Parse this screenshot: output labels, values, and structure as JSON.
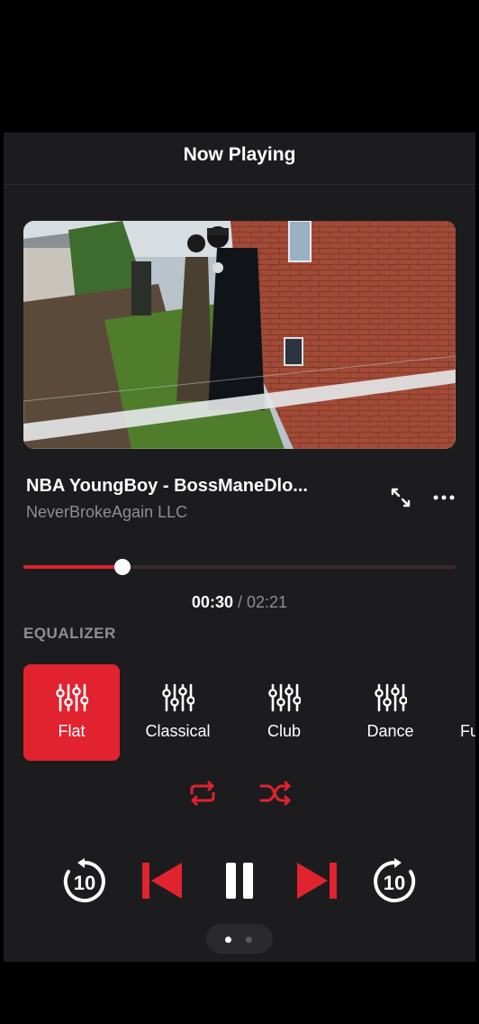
{
  "header": {
    "title": "Now Playing"
  },
  "track": {
    "title": "NBA YoungBoy - BossManeDlo...",
    "artist": "NeverBrokeAgain LLC",
    "progress_fraction": 0.23
  },
  "time": {
    "current": "00:30",
    "separator": "/",
    "total": "02:21"
  },
  "equalizer": {
    "title": "EQUALIZER",
    "presets": [
      "Flat",
      "Classical",
      "Club",
      "Dance",
      "Fu"
    ],
    "selected": "Flat"
  },
  "controls": {
    "skip_back_seconds": "10",
    "skip_forward_seconds": "10"
  },
  "pager": {
    "pages": 2,
    "current": 1
  },
  "colors": {
    "accent": "#e0232e",
    "background": "#1c1c1e",
    "muted": "#8e8e93"
  },
  "icons": [
    "expand-icon",
    "more-icon",
    "equalizer-icon",
    "repeat-icon",
    "shuffle-icon",
    "rewind-10-icon",
    "previous-icon",
    "pause-icon",
    "next-icon",
    "forward-10-icon"
  ]
}
